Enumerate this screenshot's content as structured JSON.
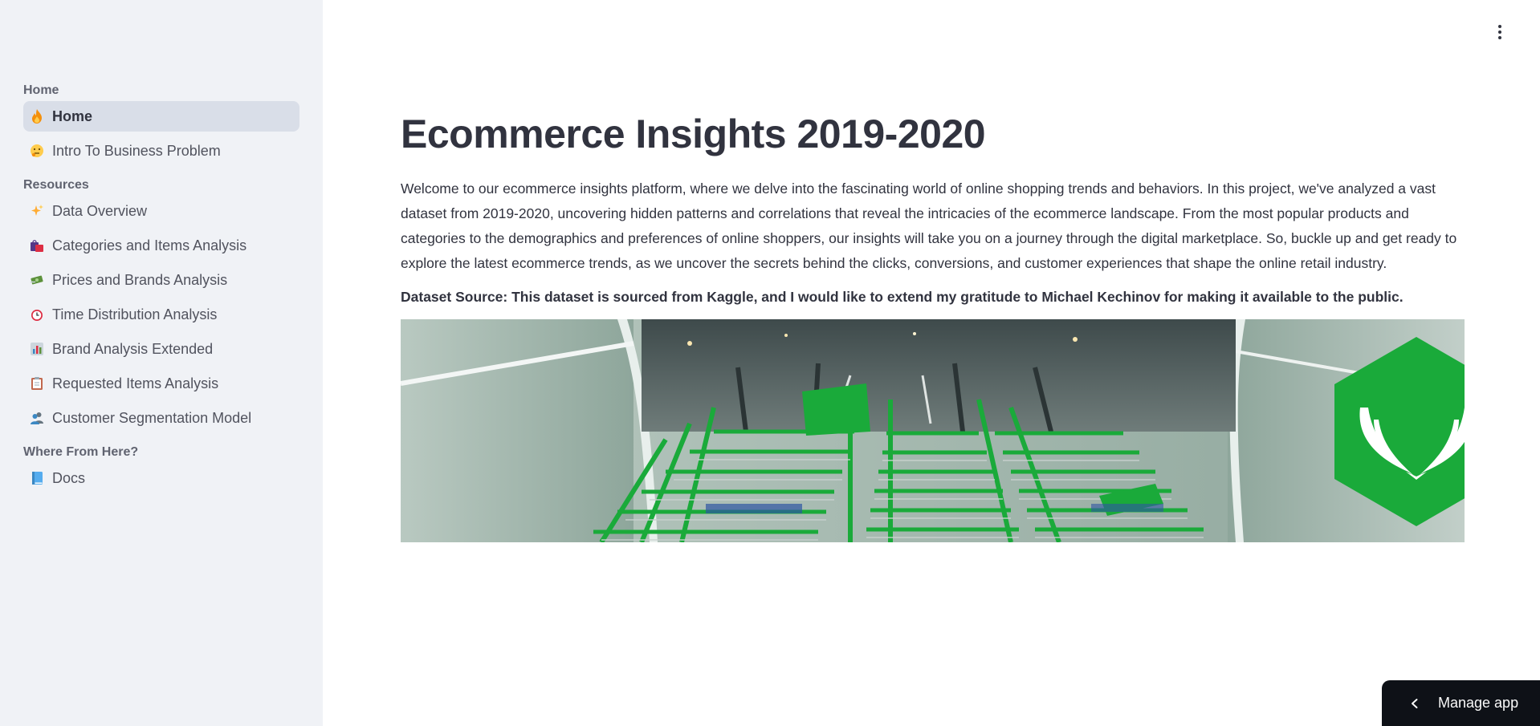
{
  "sidebar": {
    "sections": [
      {
        "label": "Home",
        "items": [
          {
            "label": "Home",
            "icon": "fire-icon",
            "active": true
          },
          {
            "label": "Intro To Business Problem",
            "icon": "thinking-face-icon"
          }
        ]
      },
      {
        "label": "Resources",
        "items": [
          {
            "label": "Data Overview",
            "icon": "sparkles-icon"
          },
          {
            "label": "Categories and Items Analysis",
            "icon": "shopping-bags-icon"
          },
          {
            "label": "Prices and Brands Analysis",
            "icon": "money-wings-icon"
          },
          {
            "label": "Time Distribution Analysis",
            "icon": "alarm-clock-icon"
          },
          {
            "label": "Brand Analysis Extended",
            "icon": "bar-chart-icon"
          },
          {
            "label": "Requested Items Analysis",
            "icon": "clipboard-icon"
          },
          {
            "label": "Customer Segmentation Model",
            "icon": "people-icon"
          }
        ]
      },
      {
        "label": "Where From Here?",
        "items": [
          {
            "label": "Docs",
            "icon": "blue-book-icon"
          }
        ]
      }
    ]
  },
  "main": {
    "title": "Ecommerce Insights 2019-2020",
    "intro": "Welcome to our ecommerce insights platform, where we delve into the fascinating world of online shopping trends and behaviors. In this project, we've analyzed a vast dataset from 2019-2020, uncovering hidden patterns and correlations that reveal the intricacies of the ecommerce landscape. From the most popular products and categories to the demographics and preferences of online shoppers, our insights will take you on a journey through the digital marketplace. So, buckle up and get ready to explore the latest ecommerce trends, as we uncover the secrets behind the clicks, conversions, and customer experiences that shape the online retail industry.",
    "source": "Dataset Source: This dataset is sourced from Kaggle, and I would like to extend my gratitude to Michael Kechinov for making it available to the public."
  },
  "manage_app": {
    "label": "Manage app"
  },
  "colors": {
    "sidebar_bg": "#f0f2f6",
    "active_bg": "#d9dee8",
    "brand_green": "#1aaa3a",
    "dark": "#0e1117"
  }
}
